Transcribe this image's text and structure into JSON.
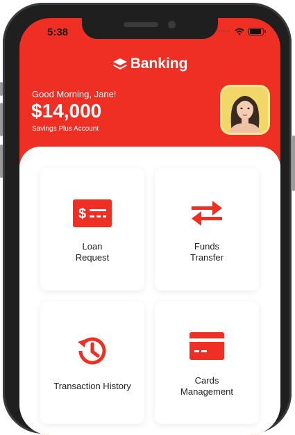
{
  "status_bar": {
    "time": "5:38"
  },
  "header": {
    "brand": "Banking",
    "greeting": "Good Morning, Jane!",
    "balance": "$14,000",
    "account": "Savings Plus Account"
  },
  "tiles": [
    {
      "line1": "Loan",
      "line2": "Request"
    },
    {
      "line1": "Funds",
      "line2": "Transfer"
    },
    {
      "line1": "Transaction History",
      "line2": ""
    },
    {
      "line1": "Cards",
      "line2": "Management"
    }
  ],
  "colors": {
    "accent": "#ef2e24",
    "background": "#ffffff"
  },
  "icons": [
    "layers-icon",
    "loan-icon",
    "transfer-icon",
    "history-icon",
    "card-icon"
  ]
}
